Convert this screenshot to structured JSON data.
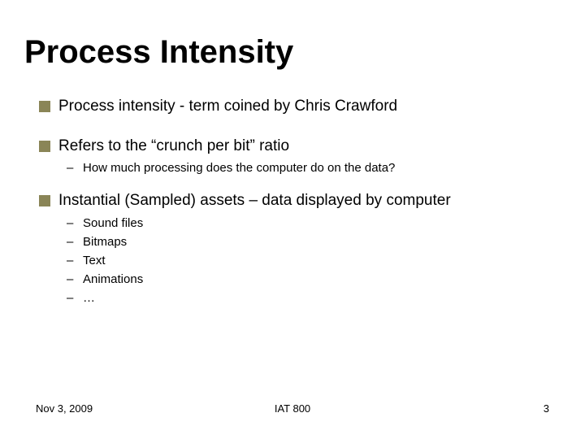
{
  "title": "Process Intensity",
  "bullets": [
    {
      "text": "Process intensity - term coined by Chris Crawford",
      "subs": []
    },
    {
      "text": "Refers to the “crunch per bit” ratio",
      "subs": [
        "How much processing does the computer do on the data?"
      ]
    },
    {
      "text": "Instantial (Sampled) assets – data displayed by computer",
      "subs": [
        "Sound files",
        "Bitmaps",
        "Text",
        "Animations",
        "…"
      ]
    }
  ],
  "footer": {
    "date": "Nov 3, 2009",
    "center": "IAT 800",
    "page": "3"
  }
}
